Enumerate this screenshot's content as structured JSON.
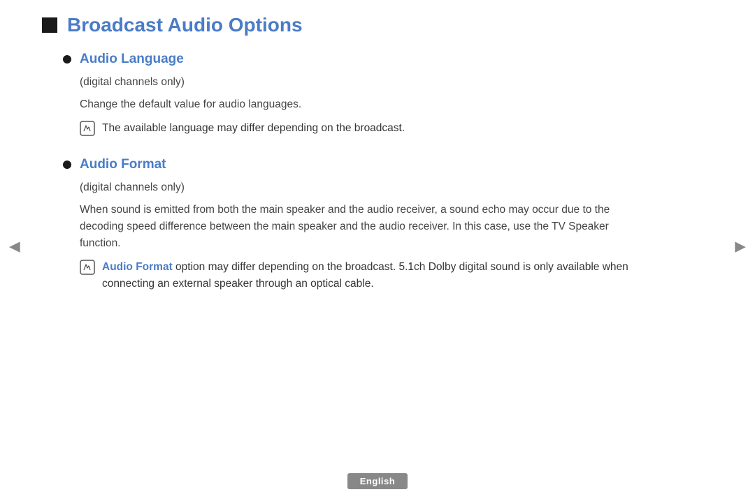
{
  "page": {
    "title": "Broadcast Audio Options",
    "title_icon": "square-icon"
  },
  "left_arrow": "◄",
  "right_arrow": "►",
  "sections": [
    {
      "id": "audio-language",
      "title": "Audio Language",
      "digital_only": "(digital channels only)",
      "description": "Change the default value for audio languages.",
      "note": "The available language may differ depending on the broadcast."
    },
    {
      "id": "audio-format",
      "title": "Audio Format",
      "digital_only": "(digital channels only)",
      "description": "When sound is emitted from both the main speaker and the audio receiver, a sound echo may occur due to the decoding speed difference between the main speaker and the audio receiver. In this case, use the TV Speaker function.",
      "note_highlight": "Audio Format",
      "note": " option may differ depending on the broadcast. 5.1ch Dolby digital sound is only available when connecting an external speaker through an optical cable."
    }
  ],
  "footer": {
    "language_badge": "English"
  },
  "note_icon_char": "🖊"
}
